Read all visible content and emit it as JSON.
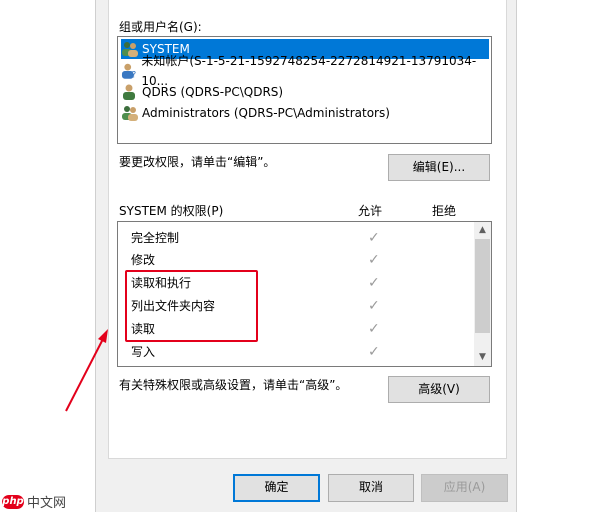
{
  "groups": {
    "label": "组或用户名(G):",
    "users": [
      {
        "name": "SYSTEM",
        "selected": true
      },
      {
        "name": "未知帐户(S-1-5-21-1592748254-2272814921-13791034-10...",
        "selected": false
      },
      {
        "name": "QDRS (QDRS-PC\\QDRS)",
        "selected": false
      },
      {
        "name": "Administrators (QDRS-PC\\Administrators)",
        "selected": false
      }
    ]
  },
  "change_hint": "要更改权限，请单击“编辑”。",
  "edit_button": "编辑(E)...",
  "permissions": {
    "label": "SYSTEM 的权限(P)",
    "allow_header": "允许",
    "deny_header": "拒绝",
    "items": [
      {
        "name": "完全控制",
        "allow": "✓"
      },
      {
        "name": "修改",
        "allow": "✓"
      },
      {
        "name": "读取和执行",
        "allow": "✓"
      },
      {
        "name": "列出文件夹内容",
        "allow": "✓"
      },
      {
        "name": "读取",
        "allow": "✓"
      },
      {
        "name": "写入",
        "allow": "✓"
      }
    ]
  },
  "advanced_hint": "有关特殊权限或高级设置，请单击“高级”。",
  "advanced_button": "高级(V)",
  "footer": {
    "ok": "确定",
    "cancel": "取消",
    "apply": "应用(A)"
  },
  "watermark": {
    "mark": "php",
    "text": "中文网"
  },
  "colors": {
    "selection": "#0078d7",
    "highlight": "#e3001b",
    "arrow": "#e3001b"
  }
}
